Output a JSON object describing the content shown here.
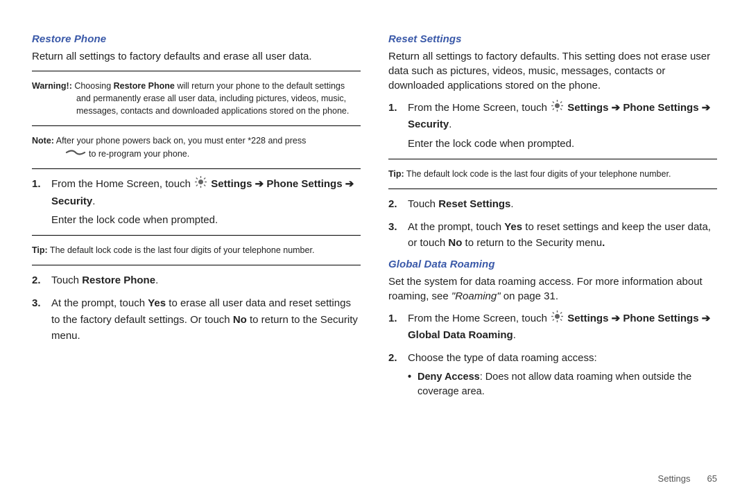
{
  "left": {
    "h1": "Restore Phone",
    "intro": "Return all settings to factory defaults and erase all user data.",
    "warning": {
      "label": "Warning!:",
      "before": " Choosing ",
      "bold": "Restore Phone",
      "after": " will return your phone to the default settings and permanently erase all user data, including pictures, videos, music, messages, contacts and downloaded applications stored on the phone."
    },
    "note": {
      "label": "Note:",
      "line1": " After your phone powers back on, you must enter *228 and press ",
      "line2": "to re-program your phone."
    },
    "step1": {
      "lead": "From the Home Screen, touch ",
      "path1a": "Settings",
      "path1b": "Phone Settings",
      "path1c": "Security",
      "sub": "Enter the lock code when prompted."
    },
    "tip": {
      "label": "Tip:",
      "text": " The default lock code is the last four digits of your telephone number."
    },
    "step2": {
      "lead": "Touch ",
      "bold": "Restore Phone",
      "end": "."
    },
    "step3": {
      "a": "At the prompt, touch ",
      "yes": "Yes",
      "b": " to erase all user data and reset settings to the factory default settings. Or touch ",
      "no": "No",
      "c": " to return to the Security menu."
    }
  },
  "right": {
    "h1": "Reset Settings",
    "intro": "Return all settings to factory defaults. This setting does not erase user data such as pictures, videos, music, messages, contacts or downloaded applications stored on the phone.",
    "step1": {
      "lead": "From the Home Screen, touch ",
      "path1a": "Settings",
      "path1b": "Phone Settings",
      "path1c": "Security",
      "sub": "Enter the lock code when prompted."
    },
    "tip": {
      "label": "Tip:",
      "text": " The default lock code is the last four digits of your telephone number."
    },
    "step2": {
      "lead": "Touch ",
      "bold": "Reset Settings",
      "end": "."
    },
    "step3": {
      "a": "At the prompt, touch ",
      "yes": "Yes",
      "b": " to reset settings and keep the user data, or touch ",
      "no": "No",
      "c": " to return to the Security menu"
    },
    "h2": "Global Data Roaming",
    "intro2a": "Set the system for data roaming access. For more information about roaming, see ",
    "intro2link": "\"Roaming\"",
    "intro2b": " on page 31.",
    "gdr_step1": {
      "lead": "From the Home Screen, touch ",
      "path1a": "Settings",
      "path1b": "Phone Settings",
      "path1c": "Global Data Roaming"
    },
    "gdr_step2": "Choose the type of data roaming access:",
    "bullet1": {
      "bold": "Deny Access",
      "text": ": Does not allow data roaming when outside the coverage area."
    }
  },
  "footer": {
    "section": "Settings",
    "page": "65"
  }
}
